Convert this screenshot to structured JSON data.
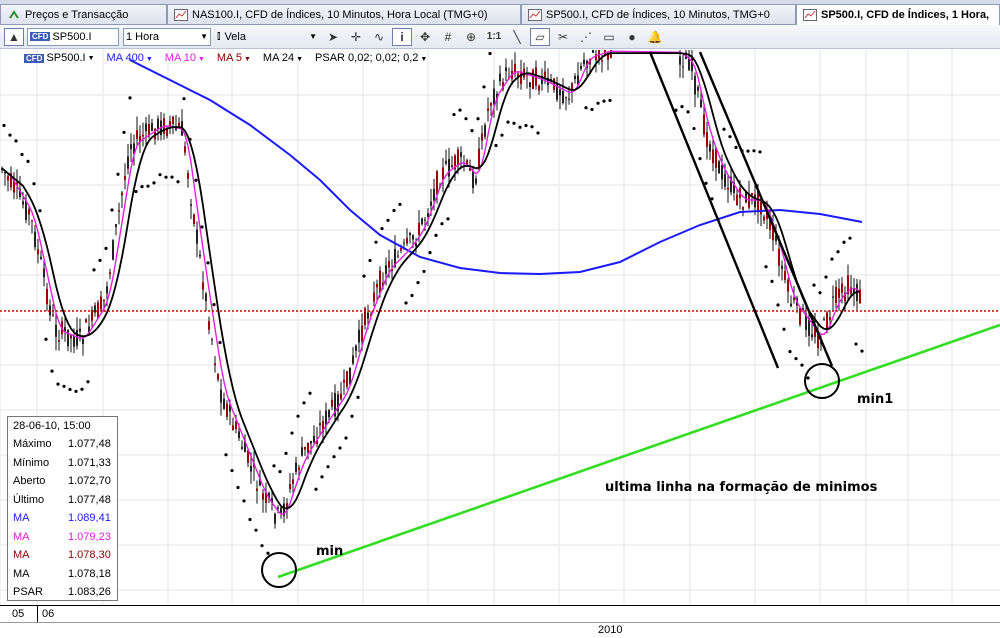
{
  "tabs": [
    {
      "label": "Preços e Transacção",
      "icon": "quotes-icon",
      "active": false
    },
    {
      "label": "NAS100.I, CFD de Índices, 10 Minutos, Hora Local (TMG+0)",
      "icon": "chart-icon",
      "active": false
    },
    {
      "label": "SP500.I, CFD de Índices, 10 Minutos, TMG+0",
      "icon": "chart-icon",
      "active": false
    },
    {
      "label": "SP500.I, CFD de Índices, 1 Hora,",
      "icon": "chart-icon",
      "active": true
    }
  ],
  "tab_close": "x",
  "toolbar": {
    "symbol_badge": "CFD",
    "symbol": "SP500.I",
    "period": "1 Hora",
    "chart_type": "Vela",
    "zoom_label": "1:1"
  },
  "indicators": [
    {
      "label": "SP500.I",
      "color": "#000000"
    },
    {
      "label": "MA 400",
      "color": "#1a1aff"
    },
    {
      "label": "MA 10",
      "color": "#e020e0"
    },
    {
      "label": "MA 5",
      "color": "#8b0000"
    },
    {
      "label": "MA 24",
      "color": "#000000"
    },
    {
      "label": "PSAR 0,02; 0,02; 0,2",
      "color": "#000000"
    }
  ],
  "info_box": {
    "date": "28-06-10, 15:00",
    "rows": [
      {
        "label": "Máximo",
        "value": "1.077,48",
        "color": "#000000"
      },
      {
        "label": "Mínimo",
        "value": "1.071,33",
        "color": "#000000"
      },
      {
        "label": "Aberto",
        "value": "1.072,70",
        "color": "#000000"
      },
      {
        "label": "Último",
        "value": "1.077,48",
        "color": "#000000"
      },
      {
        "label": "MA",
        "value": "1.089,41",
        "color": "#1a1aff"
      },
      {
        "label": "MA",
        "value": "1.079,23",
        "color": "#e020e0"
      },
      {
        "label": "MA",
        "value": "1.078,30",
        "color": "#8b0000"
      },
      {
        "label": "MA",
        "value": "1.078,18",
        "color": "#000000"
      },
      {
        "label": "PSAR",
        "value": "1.083,26",
        "color": "#000000"
      }
    ]
  },
  "annotations": {
    "min": "min",
    "min1": "min1",
    "trend_note": "ultima linha na formação de minimos"
  },
  "x_axis": {
    "labels": [
      "05",
      "06"
    ],
    "year": "2010"
  },
  "colors": {
    "trend_line": "#33dd22",
    "price_level": "#cc0000",
    "ma400": "#1a1aff",
    "ma10": "#e020e0",
    "ma5": "#8b0000",
    "ma24": "#000000"
  }
}
